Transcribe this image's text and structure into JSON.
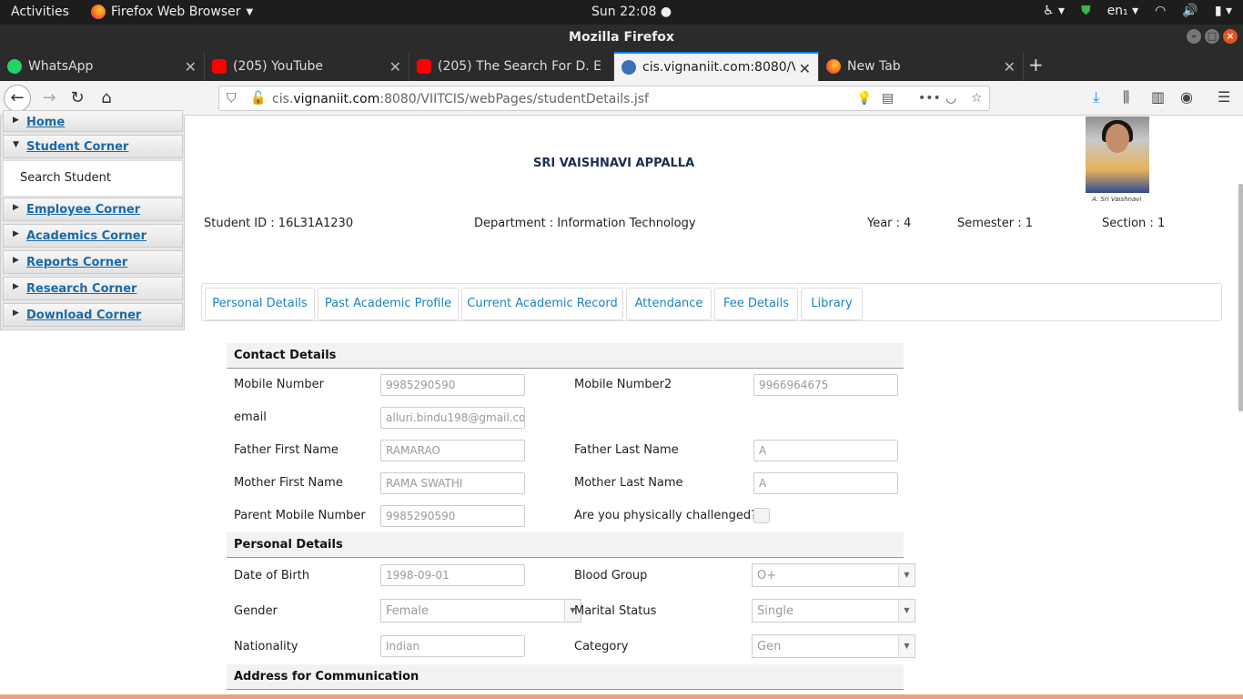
{
  "system": {
    "activities": "Activities",
    "app_name": "Firefox Web Browser",
    "clock": "Sun 22:08 ●",
    "lang": "en₁"
  },
  "window": {
    "title": "Mozilla Firefox"
  },
  "tabs": [
    {
      "label": "WhatsApp",
      "icon": "whatsapp-icon",
      "color": "#25d366"
    },
    {
      "label": "(205) YouTube",
      "icon": "youtube-icon",
      "color": "#ff0000"
    },
    {
      "label": "(205) The Search For D. E",
      "icon": "youtube-icon",
      "color": "#ff0000"
    },
    {
      "label": "cis.vignaniit.com:8080/V",
      "icon": "site-icon",
      "color": "#3b6fb6"
    },
    {
      "label": "New Tab",
      "icon": "firefox-icon",
      "color": "#ff7139"
    }
  ],
  "url": {
    "prefix": "cis.",
    "domain": "vignaniit.com",
    "rest": ":8080/VIITCIS/webPages/studentDetails.jsf"
  },
  "sidebar": {
    "items": [
      {
        "label": "Home"
      },
      {
        "label": "Student Corner"
      },
      {
        "label": "Employee Corner"
      },
      {
        "label": "Academics Corner"
      },
      {
        "label": "Reports Corner"
      },
      {
        "label": "Research Corner"
      },
      {
        "label": "Download Corner"
      }
    ],
    "sub_item": "Search Student"
  },
  "student": {
    "name": "SRI VAISHNAVI APPALLA",
    "id": "Student ID : 16L31A1230",
    "department": "Department : Information Technology",
    "year": "Year : 4",
    "semester": "Semester : 1",
    "section": "Section : 1",
    "signature": "A. Sri Vaishnavi"
  },
  "page_tabs": [
    "Personal Details",
    "Past Academic Profile",
    "Current Academic Record",
    "Attendance",
    "Fee Details",
    "Library"
  ],
  "contact": {
    "heading": "Contact Details",
    "mobile_label": "Mobile Number",
    "mobile": "9985290590",
    "mobile2_label": "Mobile Number2",
    "mobile2": "9966964675",
    "email_label": "email",
    "email": "alluri.bindu198@gmail.com",
    "father_first_label": "Father First Name",
    "father_first": "RAMARAO",
    "father_last_label": "Father Last Name",
    "father_last": "A",
    "mother_first_label": "Mother First Name",
    "mother_first": "RAMA SWATHI",
    "mother_last_label": "Mother Last Name",
    "mother_last": "A",
    "parent_mobile_label": "Parent Mobile Number",
    "parent_mobile": "9985290590",
    "challenged_label": "Are you physically challenged?"
  },
  "personal": {
    "heading": "Personal Details",
    "dob_label": "Date of Birth",
    "dob": "1998-09-01",
    "blood_label": "Blood Group",
    "blood": "O+",
    "gender_label": "Gender",
    "gender": "Female",
    "marital_label": "Marital Status",
    "marital": "Single",
    "nationality_label": "Nationality",
    "nationality": "Indian",
    "category_label": "Category",
    "category": "Gen"
  },
  "address": {
    "heading": "Address for Communication"
  }
}
